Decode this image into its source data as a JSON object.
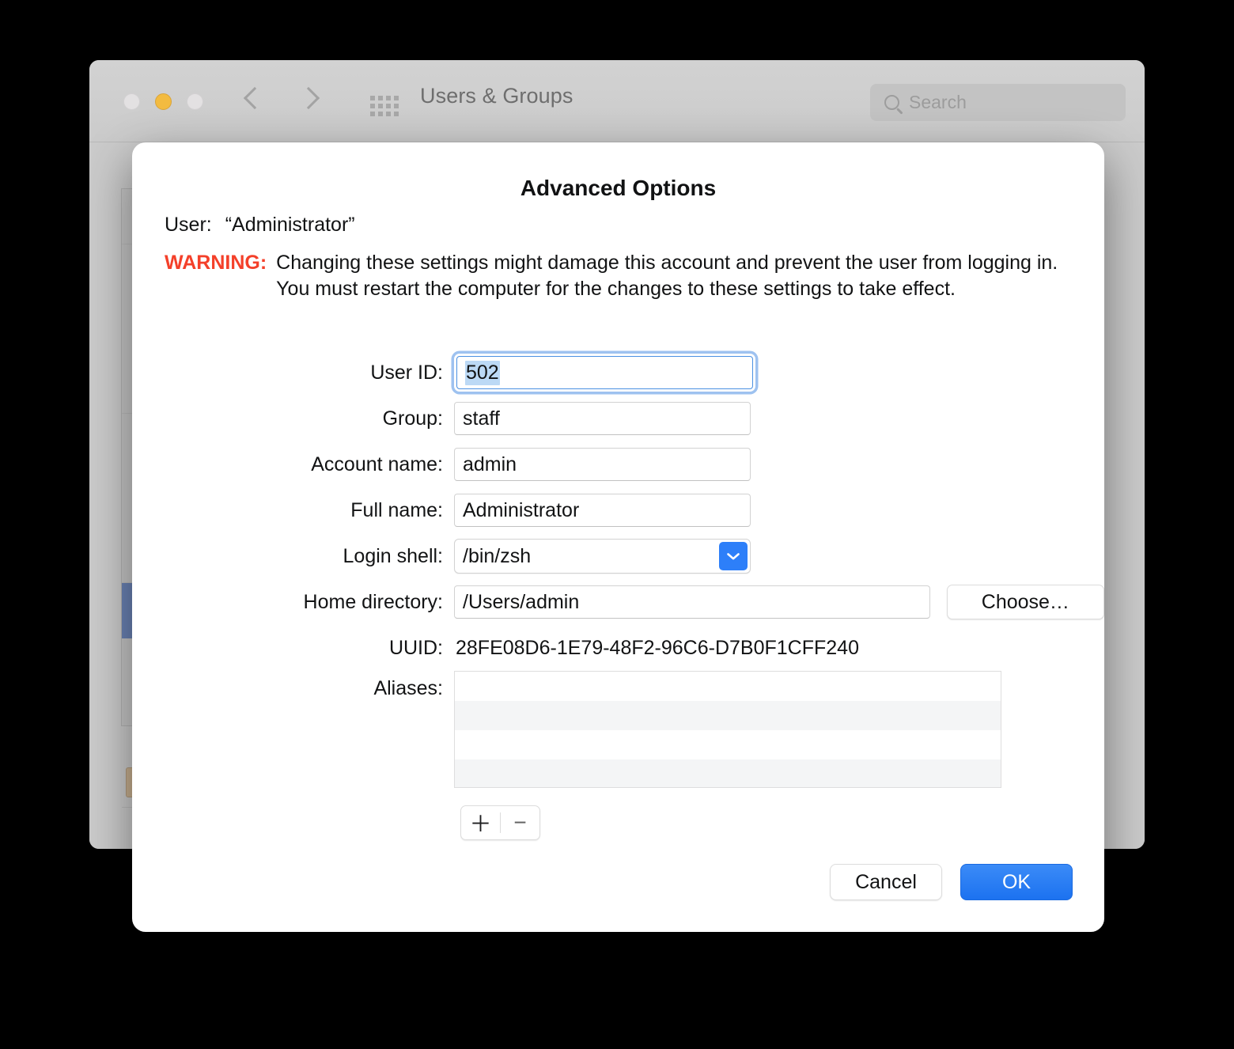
{
  "window": {
    "title": "Users & Groups",
    "traffic_lights": [
      "close",
      "minimize",
      "zoom"
    ],
    "search": {
      "placeholder": "Search",
      "value": ""
    }
  },
  "dialog": {
    "title": "Advanced Options",
    "user_label": "User:",
    "user_value": "“Administrator”",
    "warning_label": "WARNING:",
    "warning_text": "Changing these settings might damage this account and prevent the user from logging in. You must restart the computer for the changes to these settings to take effect.",
    "warning_color": "#f4402a",
    "fields": {
      "user_id": {
        "label": "User ID:",
        "value": "502",
        "focused": true,
        "selected": true
      },
      "group": {
        "label": "Group:",
        "value": "staff"
      },
      "account_name": {
        "label": "Account name:",
        "value": "admin"
      },
      "full_name": {
        "label": "Full name:",
        "value": "Administrator"
      },
      "login_shell": {
        "label": "Login shell:",
        "value": "/bin/zsh",
        "type": "combobox"
      },
      "home_directory": {
        "label": "Home directory:",
        "value": "/Users/admin"
      },
      "uuid": {
        "label": "UUID:",
        "value": "28FE08D6-1E79-48F2-96C6-D7B0F1CFF240"
      },
      "aliases": {
        "label": "Aliases:",
        "items": []
      }
    },
    "choose_button": "Choose…",
    "alias_add": "＋",
    "alias_remove": "−",
    "cancel_button": "Cancel",
    "ok_button": "OK",
    "accent_color": "#2d7ff9"
  }
}
